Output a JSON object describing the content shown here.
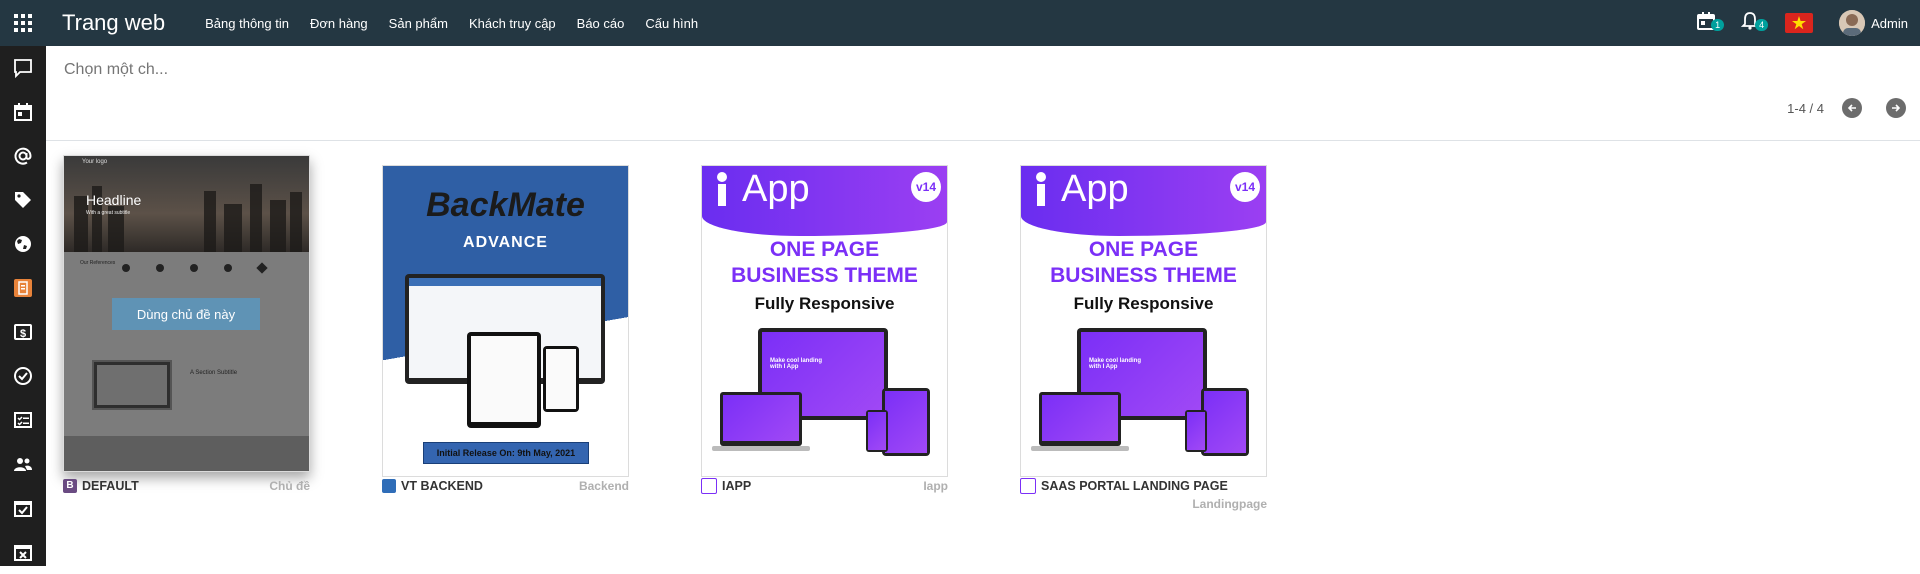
{
  "header": {
    "app_title": "Trang web",
    "menu": [
      "Bảng thông tin",
      "Đơn hàng",
      "Sản phẩm",
      "Khách truy cập",
      "Báo cáo",
      "Cấu hình"
    ],
    "activity_count": "1",
    "notification_count": "4",
    "user_name": "Admin"
  },
  "sidebar": {
    "icons": [
      "chat-icon",
      "calendar-icon",
      "at-sign-icon",
      "tag-icon",
      "globe-icon",
      "document-app-icon",
      "dollar-icon",
      "check-circle-icon",
      "checklist-icon",
      "users-icon",
      "calendar-check-icon",
      "calendar-x-icon"
    ]
  },
  "search": {
    "placeholder": "Chọn một ch..."
  },
  "pager": {
    "value": "1-4 / 4"
  },
  "themes": [
    {
      "name": "DEFAULT",
      "category": "Chủ đề",
      "use_button": "Dùng chủ đề này",
      "preview": {
        "logo": "Your logo",
        "headline": "Headline",
        "subtitle": "With a great subtitle",
        "references": "Our References",
        "section_subtitle": "A Section Subtitle"
      }
    },
    {
      "name": "VT BACKEND",
      "category": "Backend",
      "preview": {
        "brand": "BackMate",
        "edition": "ADVANCE",
        "release": "Initial Release On: 9th May, 2021"
      }
    },
    {
      "name": "IAPP",
      "category": "Iapp",
      "preview": {
        "brand": "App",
        "version": "v14",
        "line1": "ONE PAGE",
        "line2": "BUSINESS THEME",
        "line3": "Fully Responsive",
        "screen_text": "Make cool landing with I App"
      }
    },
    {
      "name": "SAAS PORTAL LANDING PAGE",
      "category": "Landingpage",
      "preview": {
        "brand": "App",
        "version": "v14",
        "line1": "ONE PAGE",
        "line2": "BUSINESS THEME",
        "line3": "Fully Responsive",
        "screen_text": "Make cool landing with I App"
      }
    }
  ],
  "colors": {
    "topbar": "#243742",
    "sidebar": "#1f1f1f",
    "accent": "#00a09d",
    "purple": "#7b2ff7",
    "backmate_blue": "#2f5fa5"
  }
}
